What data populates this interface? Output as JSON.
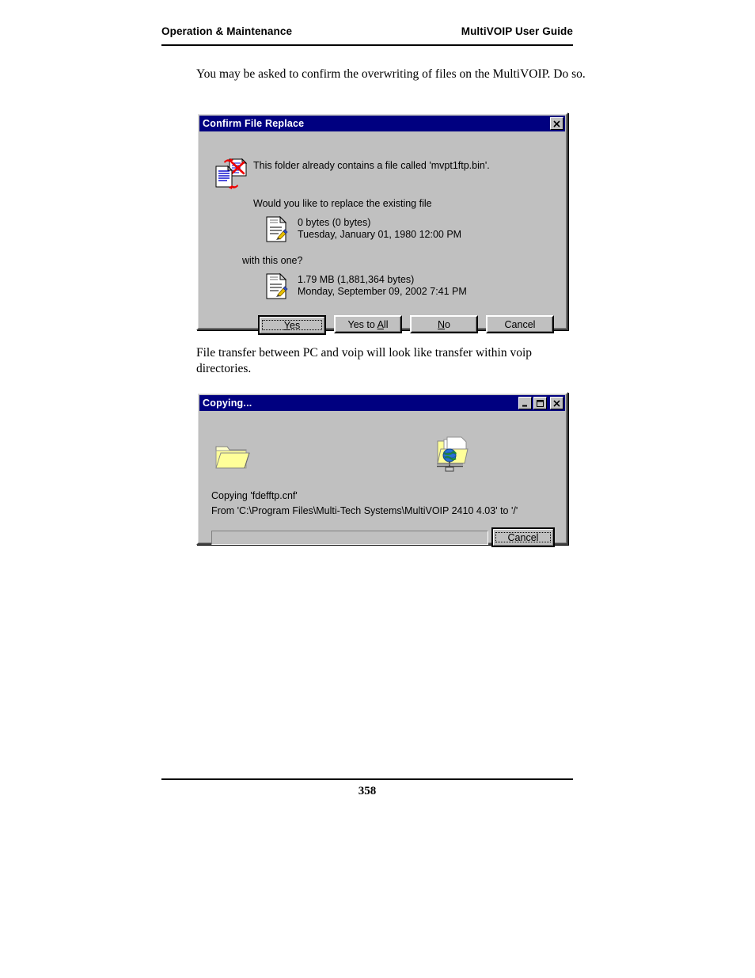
{
  "header": {
    "left": "Operation & Maintenance",
    "right": "MultiVOIP User Guide"
  },
  "paragraphs": {
    "intro": "You may be asked to confirm the overwriting of files on the MultiVOIP. Do so.",
    "transfer": "File transfer between PC and voip will look like transfer within voip directories."
  },
  "confirm_dialog": {
    "title": "Confirm File Replace",
    "close_label": "×",
    "message_main": "This folder already contains a file called 'mvpt1ftp.bin'.",
    "message_question": "Would you like to replace the existing file",
    "message_with": "with this one?",
    "existing_file": {
      "size": "0 bytes (0 bytes)",
      "date": "Tuesday, January 01, 1980 12:00 PM"
    },
    "new_file": {
      "size": "1.79 MB (1,881,364 bytes)",
      "date": "Monday, September 09, 2002 7:41 PM"
    },
    "buttons": {
      "yes": "Yes",
      "yes_to_all_pre": "Yes to ",
      "yes_to_all_accel": "A",
      "yes_to_all_post": "ll",
      "no_accel": "N",
      "no_post": "o",
      "cancel": "Cancel",
      "yes_accel": "Y",
      "yes_post": "es"
    },
    "icons": {
      "main": "file-replace-icon",
      "file_existing": "document-file-icon",
      "file_new": "document-file-icon"
    }
  },
  "copying_dialog": {
    "title": "Copying...",
    "minimize_label": "_",
    "maximize_label": "□",
    "close_label": "×",
    "line_1": "Copying 'fdefftp.cnf'",
    "line_2": "From 'C:\\Program Files\\Multi-Tech Systems\\MultiVOIP 2410 4.03' to '/'",
    "cancel_button": "Cancel",
    "progress_percent": 0,
    "icons": {
      "source": "open-folder-icon",
      "destination": "network-folder-globe-icon"
    }
  },
  "footer": {
    "page_number": "358"
  },
  "colors": {
    "titlebar": "#000080",
    "dialog_face": "#c0c0c0",
    "folder_yellow": "#ffff99",
    "accent_red": "#ff0000"
  }
}
